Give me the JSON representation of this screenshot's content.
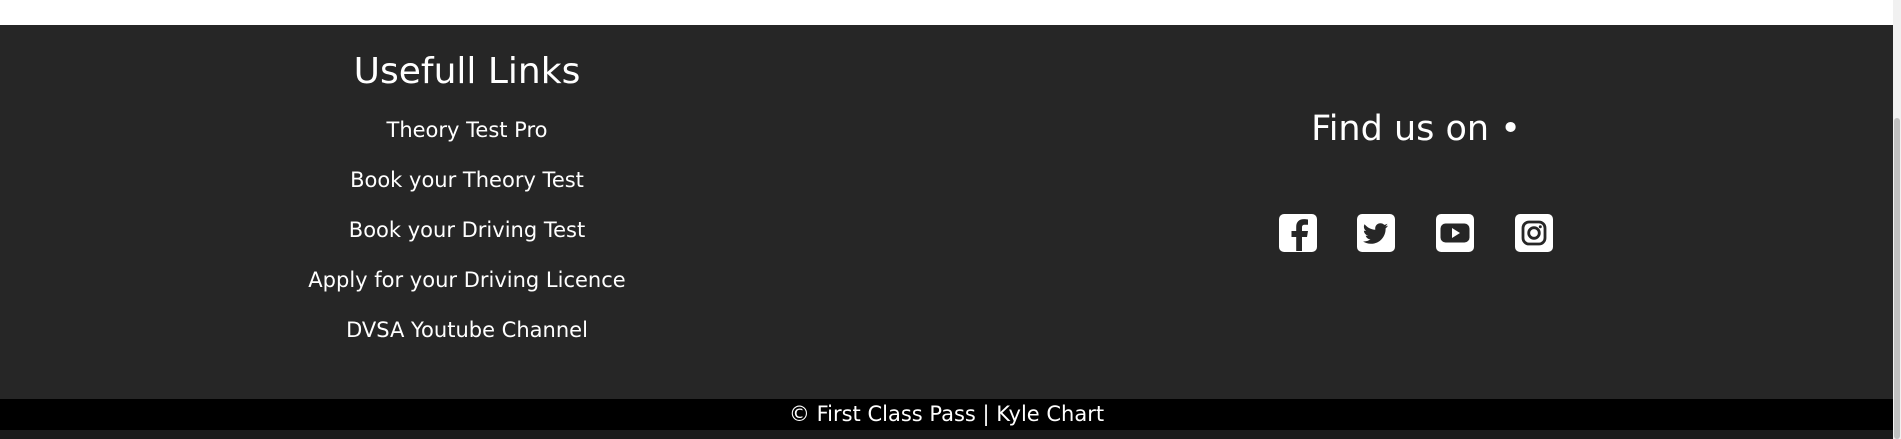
{
  "footer": {
    "links_title": "Usefull Links",
    "links": [
      {
        "label": "Theory Test Pro"
      },
      {
        "label": "Book your Theory Test"
      },
      {
        "label": "Book your Driving Test"
      },
      {
        "label": "Apply for your Driving Licence"
      },
      {
        "label": "DVSA Youtube Channel"
      }
    ],
    "social_title": "Find us on •",
    "social": [
      {
        "icon": "facebook-icon"
      },
      {
        "icon": "twitter-icon"
      },
      {
        "icon": "youtube-icon"
      },
      {
        "icon": "instagram-icon"
      }
    ],
    "copyright": "© First Class Pass | Kyle Chart"
  },
  "colors": {
    "footer_bg": "#262626",
    "copyright_bg": "#000000",
    "text": "#ffffff"
  }
}
